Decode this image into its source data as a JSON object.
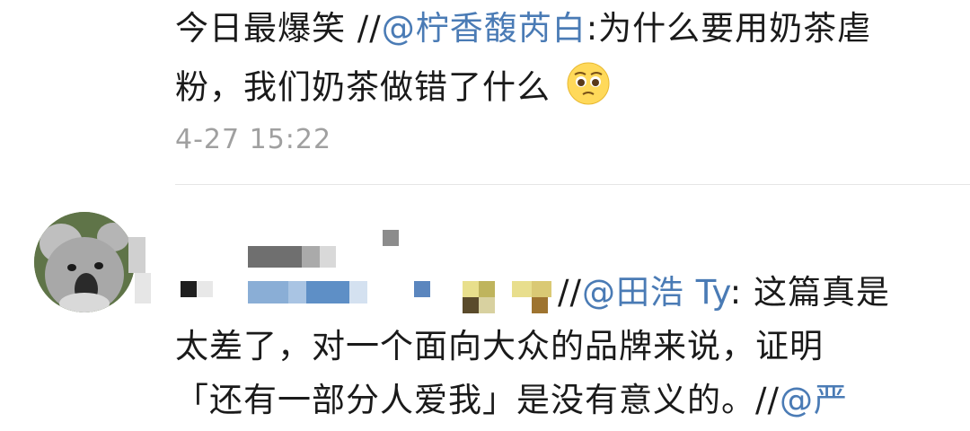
{
  "comment_top": {
    "line1_prefix": "今日最爆笑 //",
    "mention1": "@柠香馥芮白",
    "line1_suffix": ":为什么要用奶茶虐",
    "line2": "粉，我们奶茶做错了什么",
    "emoji": "pleading-face-icon",
    "timestamp": "4-27 15:22"
  },
  "comment_second": {
    "line1_prefix": "//",
    "mention2": "@田浩 Ty",
    "line1_suffix": ": 这篇真是",
    "line2": "太差了，对一个面向大众的品牌来说，证明",
    "line3_main": "「还有一部分人爱我」是没有意义的。//",
    "mention3": "@严"
  },
  "colors": {
    "mention": "#4a7bb5",
    "timestamp": "#a0a0a0",
    "text": "#1a1a1a"
  }
}
